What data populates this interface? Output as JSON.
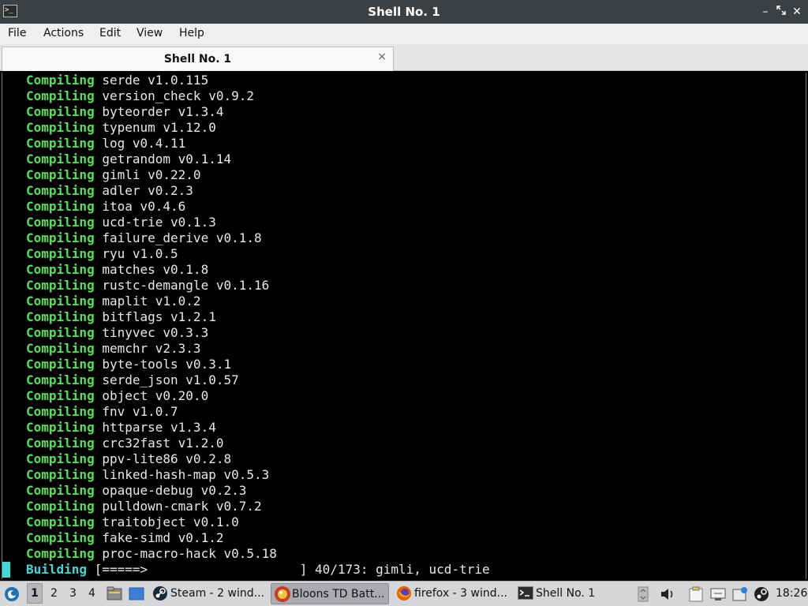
{
  "window": {
    "title": "Shell No. 1"
  },
  "menu": [
    "File",
    "Actions",
    "Edit",
    "View",
    "Help"
  ],
  "tab": {
    "label": "Shell No. 1",
    "close_glyph": "×"
  },
  "terminal": {
    "lines": [
      {
        "kw": "Compiling",
        "text": " serde v1.0.115"
      },
      {
        "kw": "Compiling",
        "text": " version_check v0.9.2"
      },
      {
        "kw": "Compiling",
        "text": " byteorder v1.3.4"
      },
      {
        "kw": "Compiling",
        "text": " typenum v1.12.0"
      },
      {
        "kw": "Compiling",
        "text": " log v0.4.11"
      },
      {
        "kw": "Compiling",
        "text": " getrandom v0.1.14"
      },
      {
        "kw": "Compiling",
        "text": " gimli v0.22.0"
      },
      {
        "kw": "Compiling",
        "text": " adler v0.2.3"
      },
      {
        "kw": "Compiling",
        "text": " itoa v0.4.6"
      },
      {
        "kw": "Compiling",
        "text": " ucd-trie v0.1.3"
      },
      {
        "kw": "Compiling",
        "text": " failure_derive v0.1.8"
      },
      {
        "kw": "Compiling",
        "text": " ryu v1.0.5"
      },
      {
        "kw": "Compiling",
        "text": " matches v0.1.8"
      },
      {
        "kw": "Compiling",
        "text": " rustc-demangle v0.1.16"
      },
      {
        "kw": "Compiling",
        "text": " maplit v1.0.2"
      },
      {
        "kw": "Compiling",
        "text": " bitflags v1.2.1"
      },
      {
        "kw": "Compiling",
        "text": " tinyvec v0.3.3"
      },
      {
        "kw": "Compiling",
        "text": " memchr v2.3.3"
      },
      {
        "kw": "Compiling",
        "text": " byte-tools v0.3.1"
      },
      {
        "kw": "Compiling",
        "text": " serde_json v1.0.57"
      },
      {
        "kw": "Compiling",
        "text": " object v0.20.0"
      },
      {
        "kw": "Compiling",
        "text": " fnv v1.0.7"
      },
      {
        "kw": "Compiling",
        "text": " httparse v1.3.4"
      },
      {
        "kw": "Compiling",
        "text": " crc32fast v1.2.0"
      },
      {
        "kw": "Compiling",
        "text": " ppv-lite86 v0.2.8"
      },
      {
        "kw": "Compiling",
        "text": " linked-hash-map v0.5.3"
      },
      {
        "kw": "Compiling",
        "text": " opaque-debug v0.2.3"
      },
      {
        "kw": "Compiling",
        "text": " pulldown-cmark v0.7.2"
      },
      {
        "kw": "Compiling",
        "text": " traitobject v0.1.0"
      },
      {
        "kw": "Compiling",
        "text": " fake-simd v0.1.2"
      },
      {
        "kw": "Compiling",
        "text": " proc-macro-hack v0.5.18"
      }
    ],
    "progress": {
      "kw": "Building",
      "text": " [=====>                    ] 40/173: gimli, ucd-trie"
    },
    "colors": {
      "compiling": "#55e055",
      "building": "#3fd9d9",
      "text": "#e8e8e8",
      "background": "#000000"
    }
  },
  "taskbar": {
    "workspaces": [
      "1",
      "2",
      "3",
      "4"
    ],
    "active_workspace": "1",
    "tasks": [
      {
        "label": "Steam - 2 wind...",
        "icon": "steam-icon",
        "active": false
      },
      {
        "label": "Bloons TD Batt...",
        "icon": "bloons-icon",
        "active": true
      },
      {
        "label": "firefox - 3 wind...",
        "icon": "firefox-icon",
        "active": false
      },
      {
        "label": "Shell No. 1",
        "icon": "terminal-icon",
        "active": false
      }
    ],
    "clock": "18:26"
  }
}
